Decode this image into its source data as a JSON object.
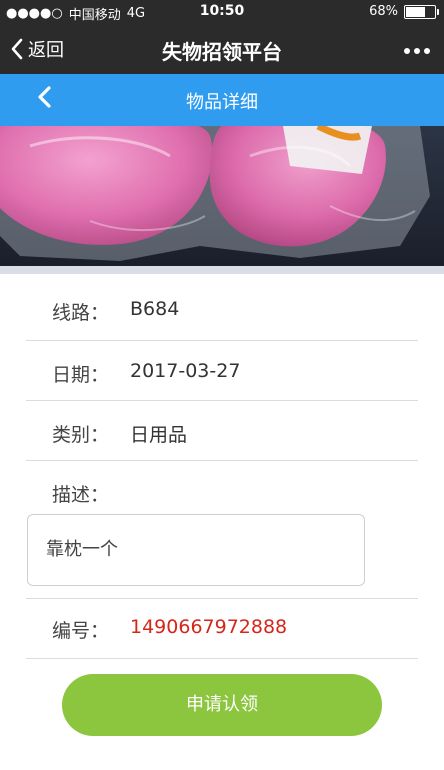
{
  "status_bar": {
    "signal": "●●●●○",
    "carrier": "中国移动",
    "network": "4G",
    "time": "10:50",
    "battery": "68%",
    "battery_level": 0.68
  },
  "wechat_nav": {
    "back_label": "返回",
    "title": "失物招领平台"
  },
  "page_header": {
    "title": "物品详细"
  },
  "details": {
    "route_label": "线路：",
    "route_value": "B684",
    "date_label": "日期：",
    "date_value": "2017-03-27",
    "category_label": "类别：",
    "category_value": "日用品",
    "description_label": "描述：",
    "description_value": "靠枕一个",
    "number_label": "编号：",
    "number_value": "1490667972888"
  },
  "actions": {
    "apply_label": "申请认领"
  },
  "colors": {
    "header_blue": "#2f9cf0",
    "button_green": "#8cc63f",
    "number_red": "#d4271a"
  }
}
